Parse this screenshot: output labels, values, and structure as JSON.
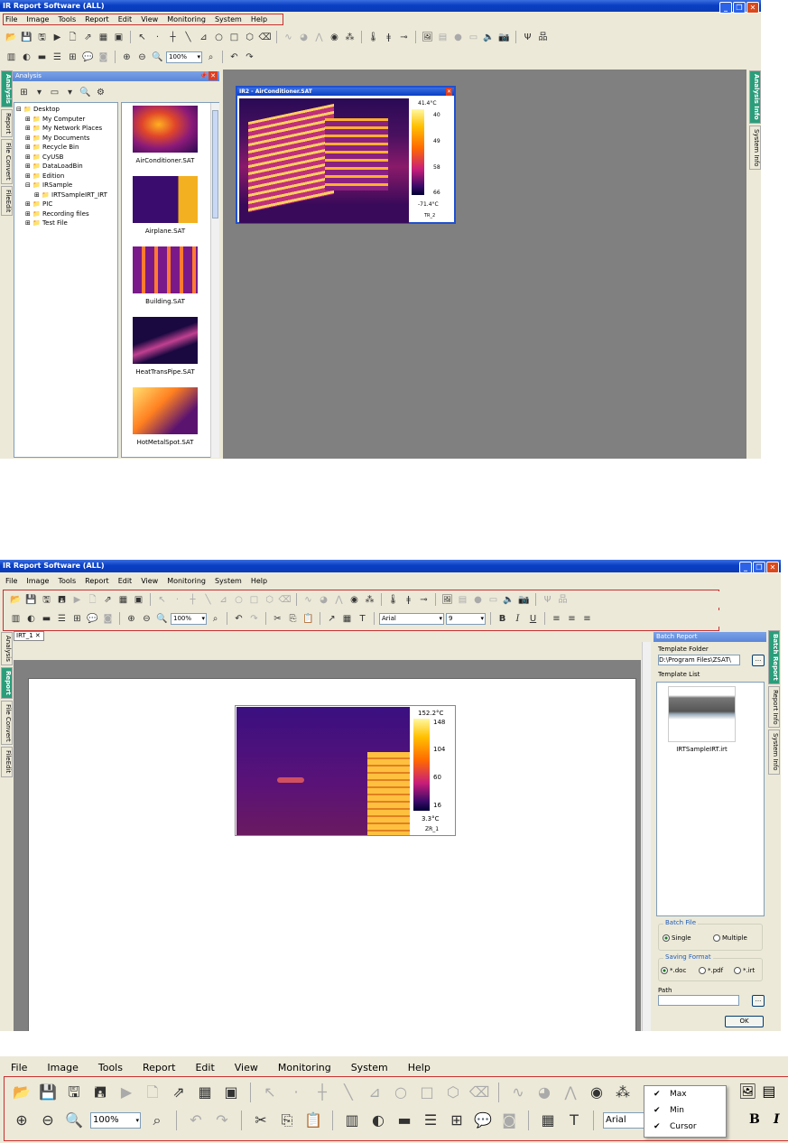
{
  "shot1": {
    "title": "IR Report Software (ALL)",
    "menu": [
      "File",
      "Image",
      "Tools",
      "Report",
      "Edit",
      "View",
      "Monitoring",
      "System",
      "Help"
    ],
    "zoom": "100%",
    "left_tabs": [
      "Analysis",
      "Report",
      "File Convert",
      "FileEdit"
    ],
    "right_tabs": [
      "Analysis Info",
      "System Info"
    ],
    "panel_title": "Analysis",
    "tree": [
      {
        "label": "Desktop",
        "level": 0,
        "expander": "⊟"
      },
      {
        "label": "My Computer",
        "level": 1,
        "expander": "⊞"
      },
      {
        "label": "My Network Places",
        "level": 1,
        "expander": "⊞"
      },
      {
        "label": "My Documents",
        "level": 1,
        "expander": "⊞"
      },
      {
        "label": "Recycle Bin",
        "level": 1,
        "expander": "⊞"
      },
      {
        "label": "CyUSB",
        "level": 1,
        "expander": "⊞"
      },
      {
        "label": "DataLoadBin",
        "level": 1,
        "expander": "⊞"
      },
      {
        "label": "Edition",
        "level": 1,
        "expander": "⊞"
      },
      {
        "label": "IRSample",
        "level": 1,
        "expander": "⊟"
      },
      {
        "label": "IRTSampleIRT_IRT",
        "level": 2,
        "expander": "⊞"
      },
      {
        "label": "PIC",
        "level": 1,
        "expander": "⊞"
      },
      {
        "label": "Recording files",
        "level": 1,
        "expander": "⊞"
      },
      {
        "label": "Test File",
        "level": 1,
        "expander": "⊞"
      }
    ],
    "thumbnails": [
      "AirConditioner.SAT",
      "Airplane.SAT",
      "Building.SAT",
      "HeatTransPipe.SAT",
      "HotMetalSpot.SAT"
    ],
    "image_window": {
      "title": "IR2 - AirConditioner.SAT",
      "max": "41.4°C",
      "ticks": [
        "40",
        "49",
        "58",
        "66"
      ],
      "min": "-71.4°C",
      "label": "TR_2"
    }
  },
  "shot2": {
    "title": "IR Report Software (ALL)",
    "menu": [
      "File",
      "Image",
      "Tools",
      "Report",
      "Edit",
      "View",
      "Monitoring",
      "System",
      "Help"
    ],
    "zoom": "100%",
    "font": "Arial",
    "font_size": "9",
    "doc_tab": "IRT_1",
    "left_tabs": [
      "Analysis",
      "Report",
      "File Convert",
      "FileEdit"
    ],
    "right_tabs": [
      "Batch Report",
      "Report Info",
      "System Info"
    ],
    "image": {
      "max": "152.2°C",
      "ticks": [
        "148",
        "104",
        "60",
        "16"
      ],
      "min": "3.3°C",
      "label": "ZR_1"
    },
    "batch": {
      "header": "Batch Report",
      "template_folder_label": "Template Folder",
      "template_folder_value": "D:\\Program Files\\ZSAT\\",
      "browse": "...",
      "template_list_label": "Template List",
      "template_name": "IRTSampleIRT.irt",
      "batch_file_label": "Batch File",
      "batch_options": [
        "Single",
        "Multiple"
      ],
      "saving_label": "Saving Format",
      "formats": [
        "*.doc",
        "*.pdf",
        "*.irt"
      ],
      "path_label": "Path",
      "ok": "OK"
    }
  },
  "shot3": {
    "menu": [
      "File",
      "Image",
      "Tools",
      "Report",
      "Edit",
      "View",
      "Monitoring",
      "System",
      "Help"
    ],
    "zoom": "100%",
    "font": "Arial",
    "dropdown": [
      "Max",
      "Min",
      "Cursor"
    ],
    "bold": "B",
    "italic": "I"
  },
  "colors": {
    "titlebar": "#0a3fc4",
    "chrome": "#ece9d8",
    "workspace": "#808080",
    "accent_tab": "#2a9e7a",
    "highlight_box": "#c83030"
  }
}
